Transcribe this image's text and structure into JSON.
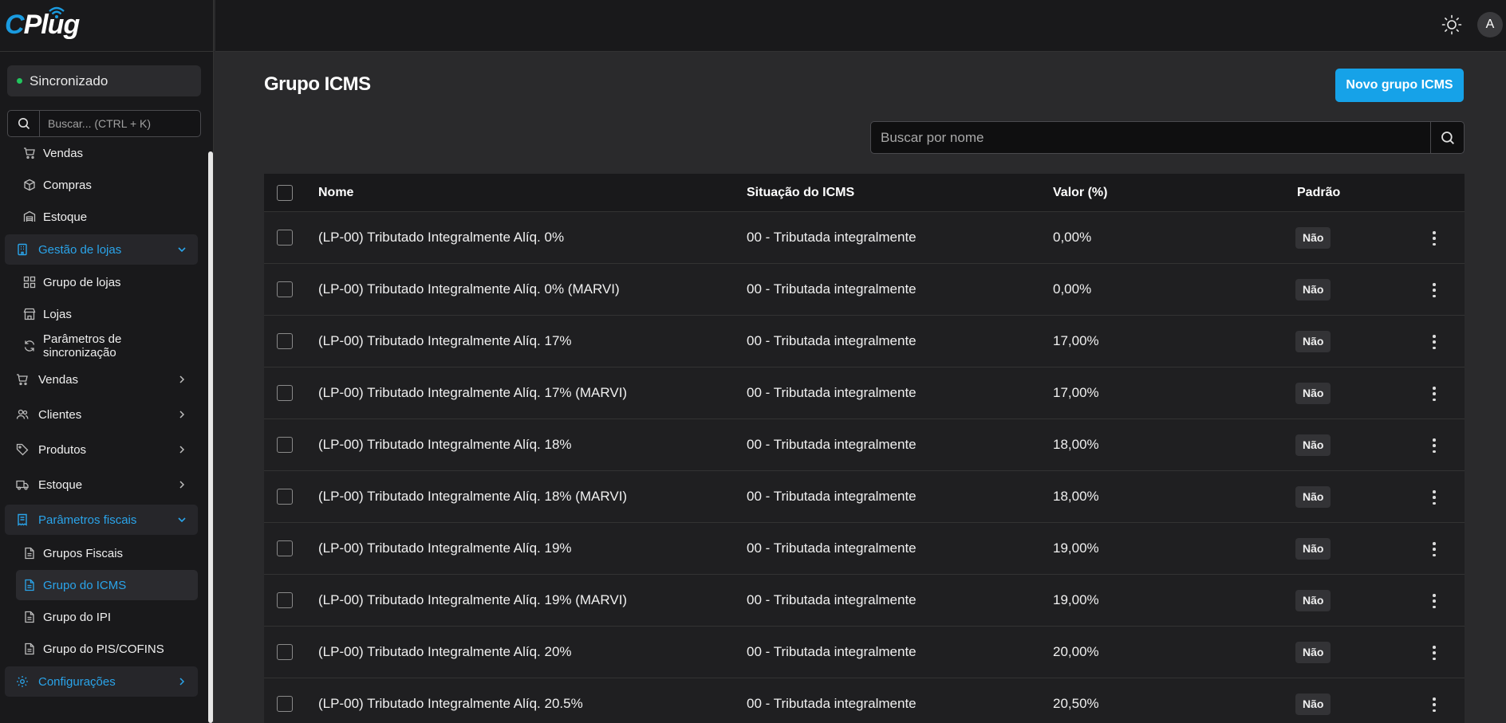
{
  "brand": {
    "logo_c": "C",
    "logo_rest": "Plug",
    "accent": "#16a2e8"
  },
  "sidebar": {
    "sync_status": "Sincronizado",
    "search_placeholder": "Buscar... (CTRL + K)",
    "items": [
      {
        "label": "Vendas",
        "icon": "cart-icon",
        "kind": "sub"
      },
      {
        "label": "Compras",
        "icon": "box-icon",
        "kind": "sub"
      },
      {
        "label": "Estoque",
        "icon": "warehouse-icon",
        "kind": "sub"
      },
      {
        "label": "Gestão de lojas",
        "icon": "building-icon",
        "kind": "group-open"
      },
      {
        "label": "Grupo de lojas",
        "icon": "grid-icon",
        "kind": "sub"
      },
      {
        "label": "Lojas",
        "icon": "store-icon",
        "kind": "sub"
      },
      {
        "label": "Parâmetros de sincronização",
        "icon": "refresh-icon",
        "kind": "sub"
      },
      {
        "label": "Vendas",
        "icon": "cart-icon",
        "kind": "top"
      },
      {
        "label": "Clientes",
        "icon": "users-icon",
        "kind": "top"
      },
      {
        "label": "Produtos",
        "icon": "tag-icon",
        "kind": "top"
      },
      {
        "label": "Estoque",
        "icon": "truck-icon",
        "kind": "top"
      },
      {
        "label": "Parâmetros fiscais",
        "icon": "receipt-icon",
        "kind": "group-open"
      },
      {
        "label": "Grupos Fiscais",
        "icon": "file-icon",
        "kind": "sub"
      },
      {
        "label": "Grupo do ICMS",
        "icon": "file-icon",
        "kind": "sub-active"
      },
      {
        "label": "Grupo do IPI",
        "icon": "file-icon",
        "kind": "sub"
      },
      {
        "label": "Grupo do PIS/COFINS",
        "icon": "file-icon",
        "kind": "sub"
      },
      {
        "label": "Configurações",
        "icon": "gear-icon",
        "kind": "group-closed"
      }
    ]
  },
  "header": {
    "avatar_initial": "A"
  },
  "main": {
    "title": "Grupo ICMS",
    "new_button": "Novo grupo ICMS",
    "search_placeholder": "Buscar por nome",
    "columns": {
      "name": "Nome",
      "situation": "Situação do ICMS",
      "value": "Valor (%)",
      "default": "Padrão"
    },
    "rows": [
      {
        "name": "(LP-00) Tributado Integralmente Alíq. 0%",
        "situation": "00 - Tributada integralmente",
        "value": "0,00%",
        "default": "Não"
      },
      {
        "name": "(LP-00) Tributado Integralmente Alíq. 0% (MARVI)",
        "situation": "00 - Tributada integralmente",
        "value": "0,00%",
        "default": "Não"
      },
      {
        "name": "(LP-00) Tributado Integralmente Alíq. 17%",
        "situation": "00 - Tributada integralmente",
        "value": "17,00%",
        "default": "Não"
      },
      {
        "name": "(LP-00) Tributado Integralmente Alíq. 17% (MARVI)",
        "situation": "00 - Tributada integralmente",
        "value": "17,00%",
        "default": "Não"
      },
      {
        "name": "(LP-00) Tributado Integralmente Alíq. 18%",
        "situation": "00 - Tributada integralmente",
        "value": "18,00%",
        "default": "Não"
      },
      {
        "name": "(LP-00) Tributado Integralmente Alíq. 18% (MARVI)",
        "situation": "00 - Tributada integralmente",
        "value": "18,00%",
        "default": "Não"
      },
      {
        "name": "(LP-00) Tributado Integralmente Alíq. 19%",
        "situation": "00 - Tributada integralmente",
        "value": "19,00%",
        "default": "Não"
      },
      {
        "name": "(LP-00) Tributado Integralmente Alíq. 19% (MARVI)",
        "situation": "00 - Tributada integralmente",
        "value": "19,00%",
        "default": "Não"
      },
      {
        "name": "(LP-00) Tributado Integralmente Alíq. 20%",
        "situation": "00 - Tributada integralmente",
        "value": "20,00%",
        "default": "Não"
      },
      {
        "name": "(LP-00) Tributado Integralmente Alíq. 20.5%",
        "situation": "00 - Tributada integralmente",
        "value": "20,50%",
        "default": "Não"
      }
    ]
  }
}
